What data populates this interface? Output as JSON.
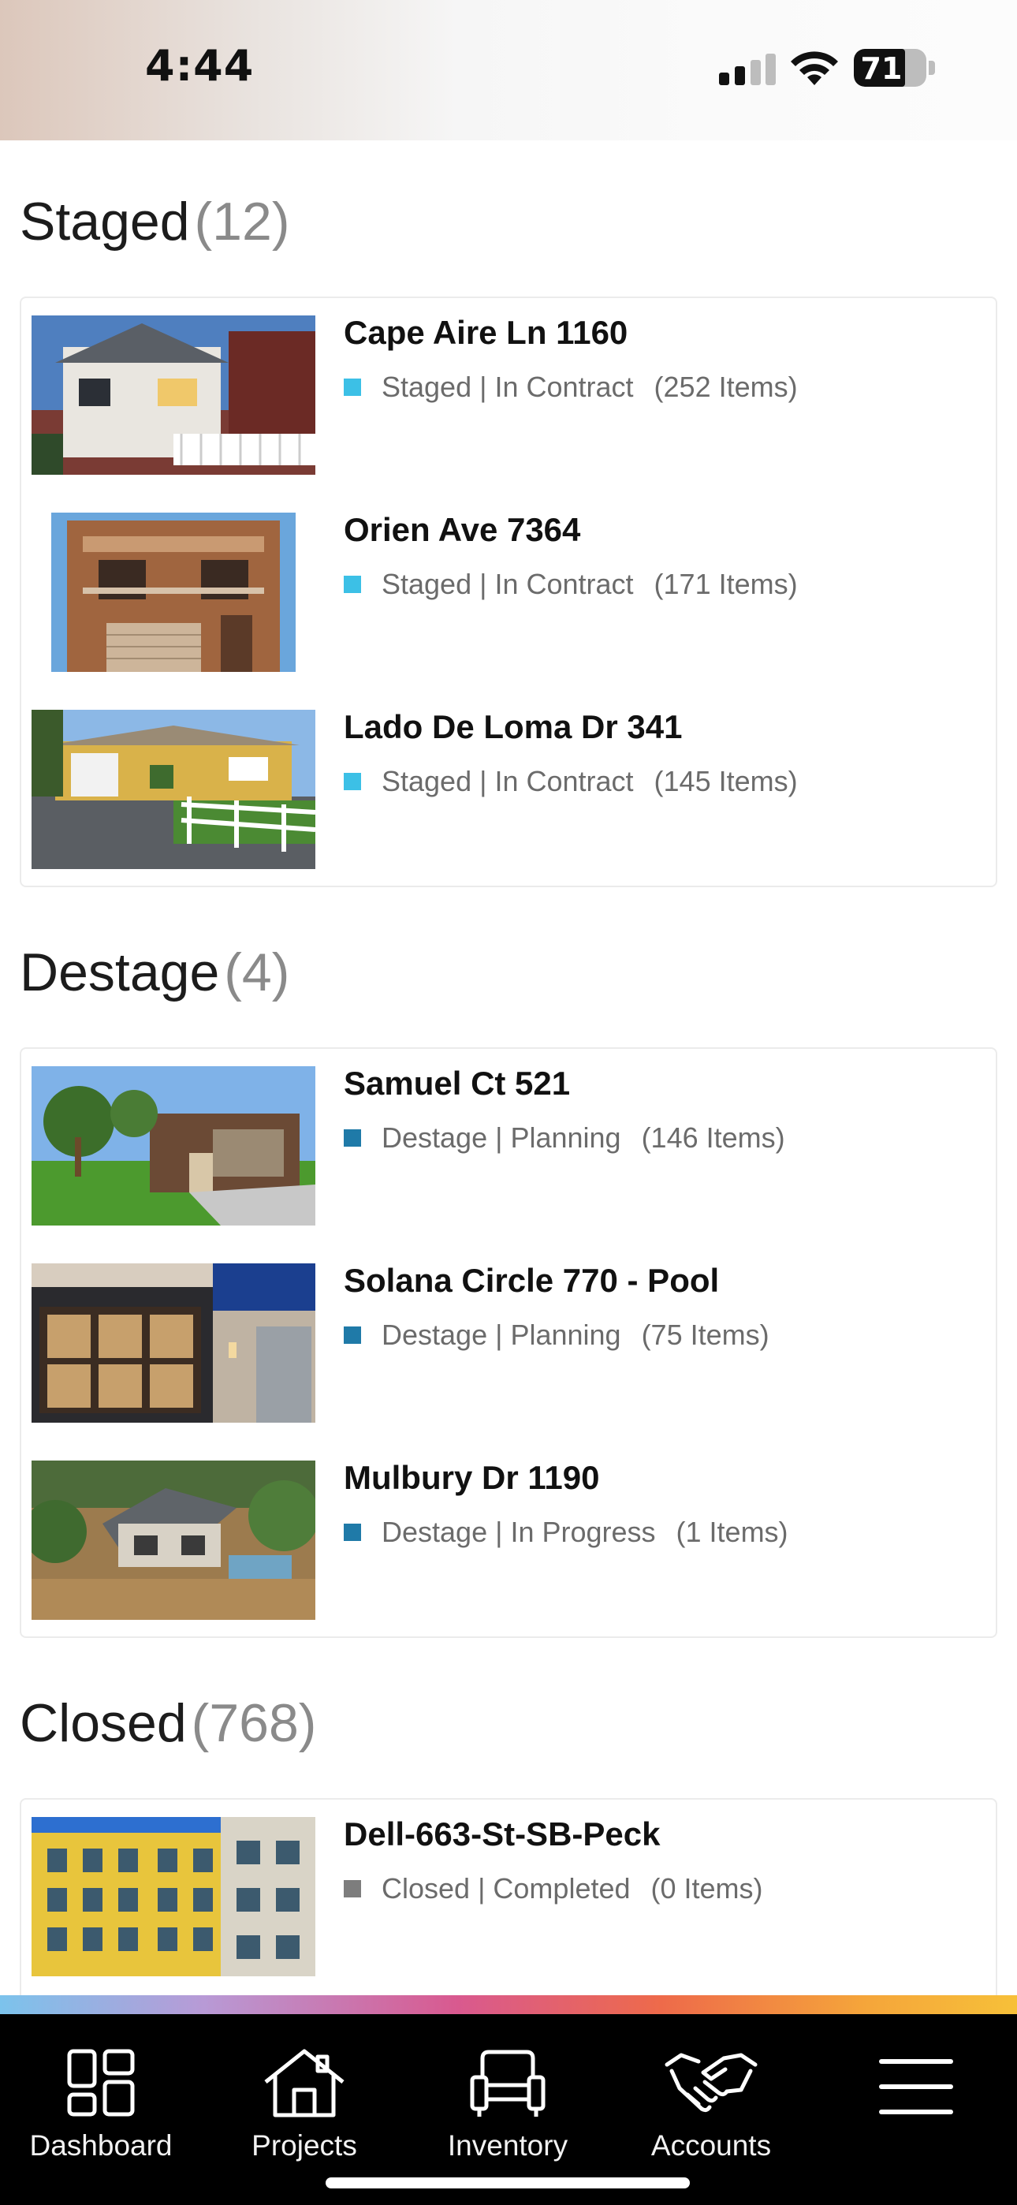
{
  "status_bar": {
    "time": "4:44",
    "battery": "71",
    "battery_level": 0.71
  },
  "sections": [
    {
      "title": "Staged",
      "count": "(12)",
      "items": [
        {
          "title": "Cape Aire Ln 1160",
          "status": "Staged | In Contract",
          "count": "(252 Items)",
          "swatch_color": "#3cc0e6"
        },
        {
          "title": "Orien Ave 7364",
          "status": "Staged | In Contract",
          "count": "(171 Items)",
          "swatch_color": "#3cc0e6"
        },
        {
          "title": "Lado De Loma Dr 341",
          "status": "Staged | In Contract",
          "count": "(145 Items)",
          "swatch_color": "#3cc0e6"
        }
      ]
    },
    {
      "title": "Destage",
      "count": "(4)",
      "items": [
        {
          "title": "Samuel Ct 521",
          "status": "Destage | Planning",
          "count": "(146 Items)",
          "swatch_color": "#1f7aa8"
        },
        {
          "title": "Solana Circle 770 - Pool",
          "status": "Destage | Planning",
          "count": "(75 Items)",
          "swatch_color": "#1f7aa8"
        },
        {
          "title": "Mulbury Dr 1190",
          "status": "Destage | In Progress",
          "count": "(1 Items)",
          "swatch_color": "#1f7aa8"
        }
      ]
    },
    {
      "title": "Closed",
      "count": "(768)",
      "items": [
        {
          "title": "Dell-663-St-SB-Peck",
          "status": "Closed | Completed",
          "count": "(0 Items)",
          "swatch_color": "#7d7d7d"
        }
      ]
    }
  ],
  "tab_bar": {
    "tabs": [
      {
        "label": "Dashboard",
        "icon": "dashboard-icon"
      },
      {
        "label": "Projects",
        "icon": "house-icon"
      },
      {
        "label": "Inventory",
        "icon": "sofa-icon"
      },
      {
        "label": "Accounts",
        "icon": "handshake-icon"
      },
      {
        "label": "",
        "icon": "hamburger-menu-icon"
      }
    ]
  }
}
